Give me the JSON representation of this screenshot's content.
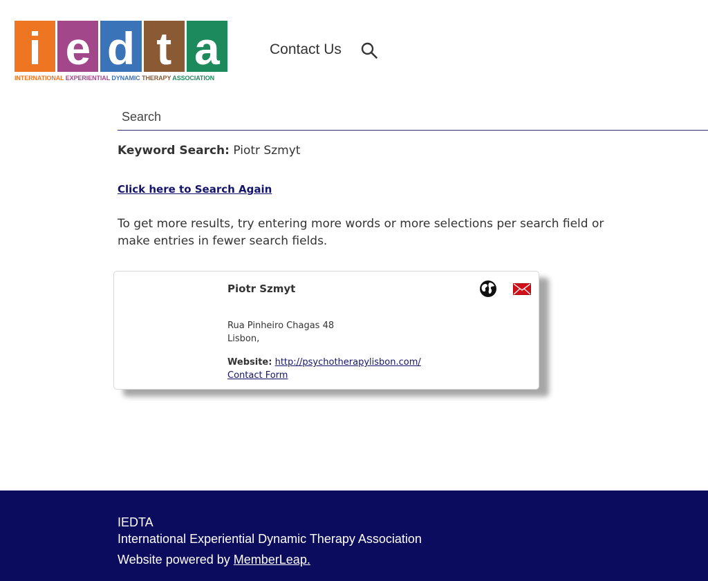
{
  "header": {
    "logo": {
      "letters": [
        "i",
        "e",
        "d",
        "t",
        "a"
      ],
      "tile_colors": [
        "#ee7623",
        "#a3478b",
        "#3b73b9",
        "#8a5a35",
        "#1d8a5e"
      ],
      "subtitle_words": [
        "INTERNATIONAL",
        "EXPERIENTIAL",
        "DYNAMIC",
        "THERAPY",
        "ASSOCIATION"
      ],
      "subtitle_colors": [
        "#ee7623",
        "#a3478b",
        "#3b73b9",
        "#8a5a35",
        "#1d8a5e"
      ]
    },
    "nav": {
      "contact_label": "Contact Us",
      "search_icon": "search-icon"
    }
  },
  "search": {
    "placeholder": "Search",
    "value": ""
  },
  "keyword": {
    "label": "Keyword Search:",
    "value": "Piotr Szmyt"
  },
  "search_again_label": "Click here to Search Again",
  "hint_text": "To get more results, try entering more words or more selections per search field or make entries in fewer search fields.",
  "result": {
    "name": "Piotr Szmyt",
    "address_line1": "Rua Pinheiro Chagas 48",
    "address_line2": "Lisbon,",
    "website_label": "Website:",
    "website_url": "http://psychotherapylisbon.com/",
    "contact_form_label": "Contact Form",
    "icons": [
      "globe-icon",
      "mail-icon"
    ]
  },
  "footer": {
    "org_short": "IEDTA",
    "org_full": "International Experiential Dynamic Therapy Association",
    "powered_prefix": "Website powered by ",
    "powered_link": "MemberLeap."
  },
  "colors": {
    "link": "#14146b",
    "footer_bg": "#0c0c5e",
    "mail_red": "#d0111b"
  }
}
